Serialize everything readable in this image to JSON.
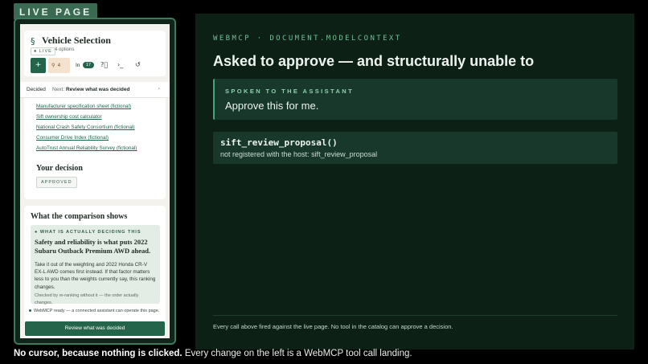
{
  "live_tag": "LIVE PAGE",
  "phone": {
    "header": {
      "title": "Vehicle Selection",
      "live_badge": "LIVE",
      "options_count": "4 options",
      "compare_count": "4",
      "in_label": "In",
      "in_badge": "17"
    },
    "decided_bar": {
      "label": "Decided",
      "next_prefix": "Next:",
      "next_action": "Review what was decided"
    },
    "sources": [
      "Manufacturer specification sheet (fictional)",
      "Sift ownership cost calculator",
      "National Crash Safety Consortium (fictional)",
      "Consumer Drive Index (fictional)",
      "AutoTrust Annual Reliability Survey (fictional)"
    ],
    "your_decision": "Your decision",
    "approved_chip": "APPROVED",
    "comparison": {
      "title": "What the comparison shows",
      "eyebrow": "WHAT IS ACTUALLY DECIDING THIS",
      "headline": "Safety and reliability is what puts 2022 Subaru Outback Premium AWD ahead.",
      "body": "Take it out of the weighting and 2022 Honda CR-V EX-L AWD comes first instead. If that factor matters less to you than the weights currently say, this ranking changes.",
      "note": "Checked by re-ranking without it — the order actually changes."
    },
    "webmcp_ready": "WebMCP ready — a connected assistant can operate this page.",
    "review_button": "Review what was decided"
  },
  "panel": {
    "eyebrow": "WEBMCP · DOCUMENT.MODELCONTEXT",
    "headline": "Asked to approve — and structurally unable to",
    "spoken_label": "SPOKEN TO THE ASSISTANT",
    "spoken_text": "Approve this for me.",
    "tool_name": "sift_review_proposal()",
    "tool_message": "not registered with the host: sift_review_proposal",
    "footer_note": "Every call above fired against the live page. No tool in the catalog can approve a decision."
  },
  "caption": {
    "bold": "No cursor, because nothing is clicked.",
    "rest": "Every change on the left is a WebMCP tool call landing."
  },
  "colors": {
    "background": "#000000",
    "panel": "#0c2016",
    "accent_green": "#24644a",
    "eyebrow_green": "#6fbf94"
  }
}
